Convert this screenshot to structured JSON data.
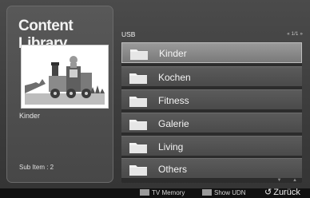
{
  "header": {
    "title": "Content Library"
  },
  "preview": {
    "label": "Kinder",
    "sub_item": "Sub Item : 2"
  },
  "browser": {
    "source": "USB",
    "pager": "« 1/1 »",
    "scroll": "▼ ▲",
    "items": [
      {
        "label": "Kinder",
        "selected": true
      },
      {
        "label": "Kochen",
        "selected": false
      },
      {
        "label": "Fitness",
        "selected": false
      },
      {
        "label": "Galerie",
        "selected": false
      },
      {
        "label": "Living",
        "selected": false
      },
      {
        "label": "Others",
        "selected": false
      }
    ]
  },
  "footer": {
    "tv_memory": "TV Memory",
    "show_udn": "Show UDN",
    "return_label": "Zurück"
  },
  "icons": {
    "folder": "folder-icon",
    "return": "return-icon"
  },
  "colors": {
    "selected_row": "#8c8c8c",
    "folder": "#f5f5f5"
  }
}
